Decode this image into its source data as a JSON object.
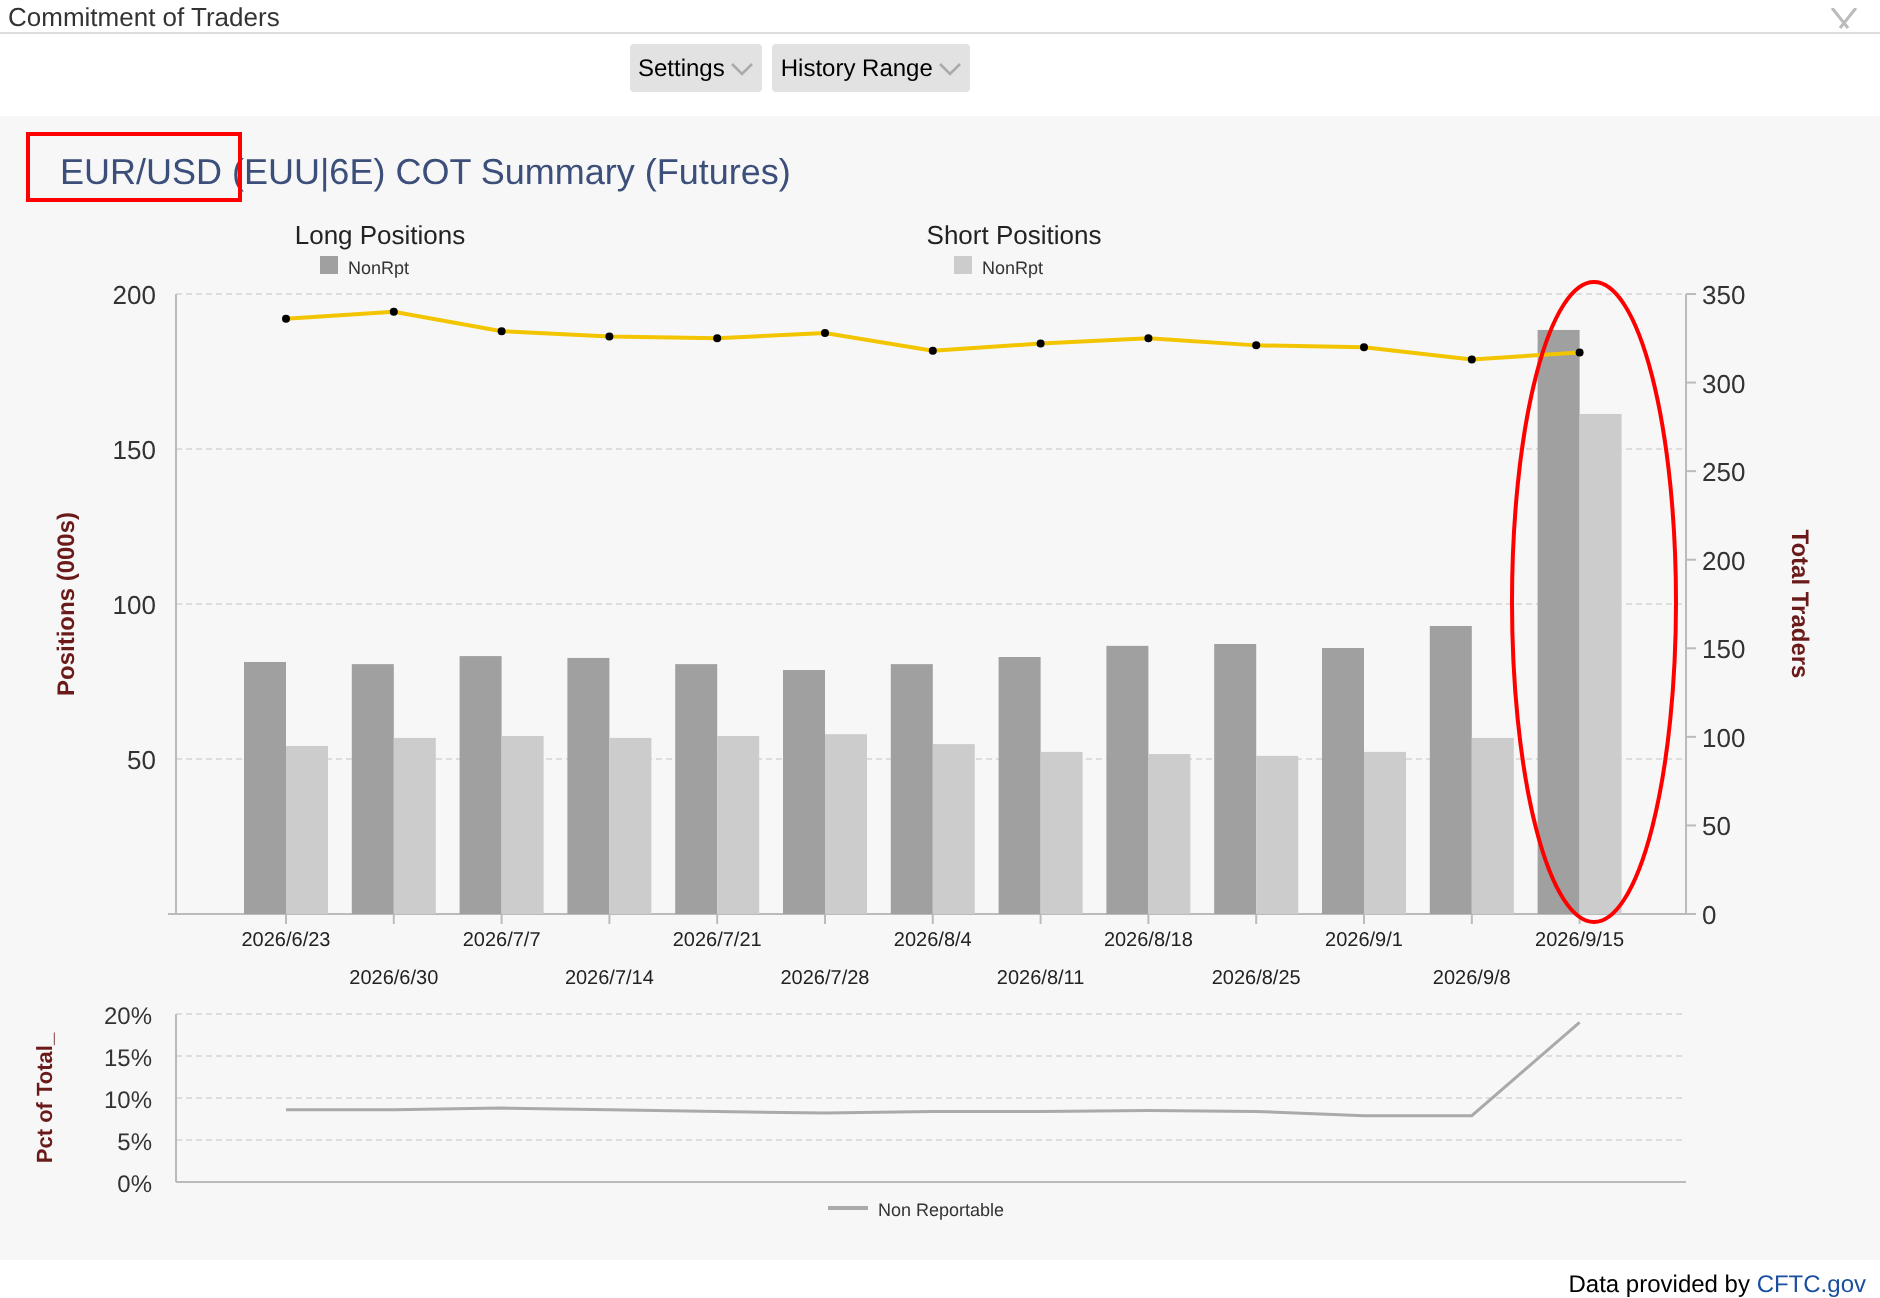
{
  "window": {
    "title": "Commitment of Traders"
  },
  "toolbar": [
    {
      "label": "Settings"
    },
    {
      "label": "History Range"
    }
  ],
  "chart_title": "EUR/USD (EUU|6E) COT Summary (Futures)",
  "main_chart": {
    "legend_groups": [
      "Long Positions",
      "Short Positions"
    ],
    "chart_data": {
      "type": "bar",
      "ylabel": "Positions (000s)",
      "grid": true,
      "y2label": "Total Traders",
      "categories": [
        "2026/6/23",
        "2026/6/30",
        "2026/7/7",
        "2026/7/14",
        "2026/7/21",
        "2026/7/28",
        "2026/8/4",
        "2026/8/11",
        "2026/8/18",
        "2026/8/25",
        "2026/9/1",
        "2026/9/8",
        "2026/9/15"
      ],
      "ylim": [
        0,
        200
      ],
      "yticks": [
        50,
        100,
        150,
        200
      ],
      "y2lim": [
        0,
        350
      ],
      "y2ticks": [
        0,
        50,
        100,
        150,
        200,
        250,
        300,
        350
      ],
      "series": [
        {
          "name": "NonRpt",
          "color": "#a0a0a0",
          "values": [
            81.3,
            80.6,
            83.2,
            82.6,
            80.6,
            78.7,
            80.6,
            82.9,
            86.5,
            87.1,
            85.8,
            92.9,
            188.4
          ]
        },
        {
          "name": "NonRpt",
          "color": "#cccccc",
          "values": [
            54.2,
            56.8,
            57.4,
            56.8,
            57.4,
            58.0,
            54.8,
            52.3,
            51.6,
            51.0,
            52.3,
            56.8,
            161.3
          ]
        },
        {
          "type": "line",
          "axis": "y2",
          "marker": true,
          "color": "#f2c500",
          "values": [
            336,
            340,
            329,
            326,
            325,
            328,
            318,
            322,
            325,
            321,
            320,
            313,
            317
          ]
        }
      ]
    }
  },
  "pct_chart": {
    "chart_data": {
      "type": "line",
      "ylabel": "Pct of Total_",
      "ylim": [
        0,
        20
      ],
      "grid": true,
      "yticks": [
        {
          "value": 0,
          "label": "0%"
        },
        {
          "value": 5,
          "label": "5%"
        },
        {
          "value": 10,
          "label": "10%"
        },
        {
          "value": 15,
          "label": "15%"
        },
        {
          "value": 20,
          "label": "20%"
        }
      ],
      "series": [
        {
          "name": "Non Reportable",
          "color": "#aaaaaa",
          "values": [
            8.6,
            8.6,
            8.8,
            8.6,
            8.4,
            8.2,
            8.4,
            8.4,
            8.5,
            8.4,
            7.9,
            7.9,
            19.0
          ]
        }
      ]
    }
  },
  "annotations": [
    {
      "kind": "rectangle",
      "color": "#ff0000"
    },
    {
      "kind": "ellipse",
      "color": "#ff0000"
    }
  ],
  "footer": {
    "text": "Data provided by",
    "link": "CFTC.gov"
  }
}
